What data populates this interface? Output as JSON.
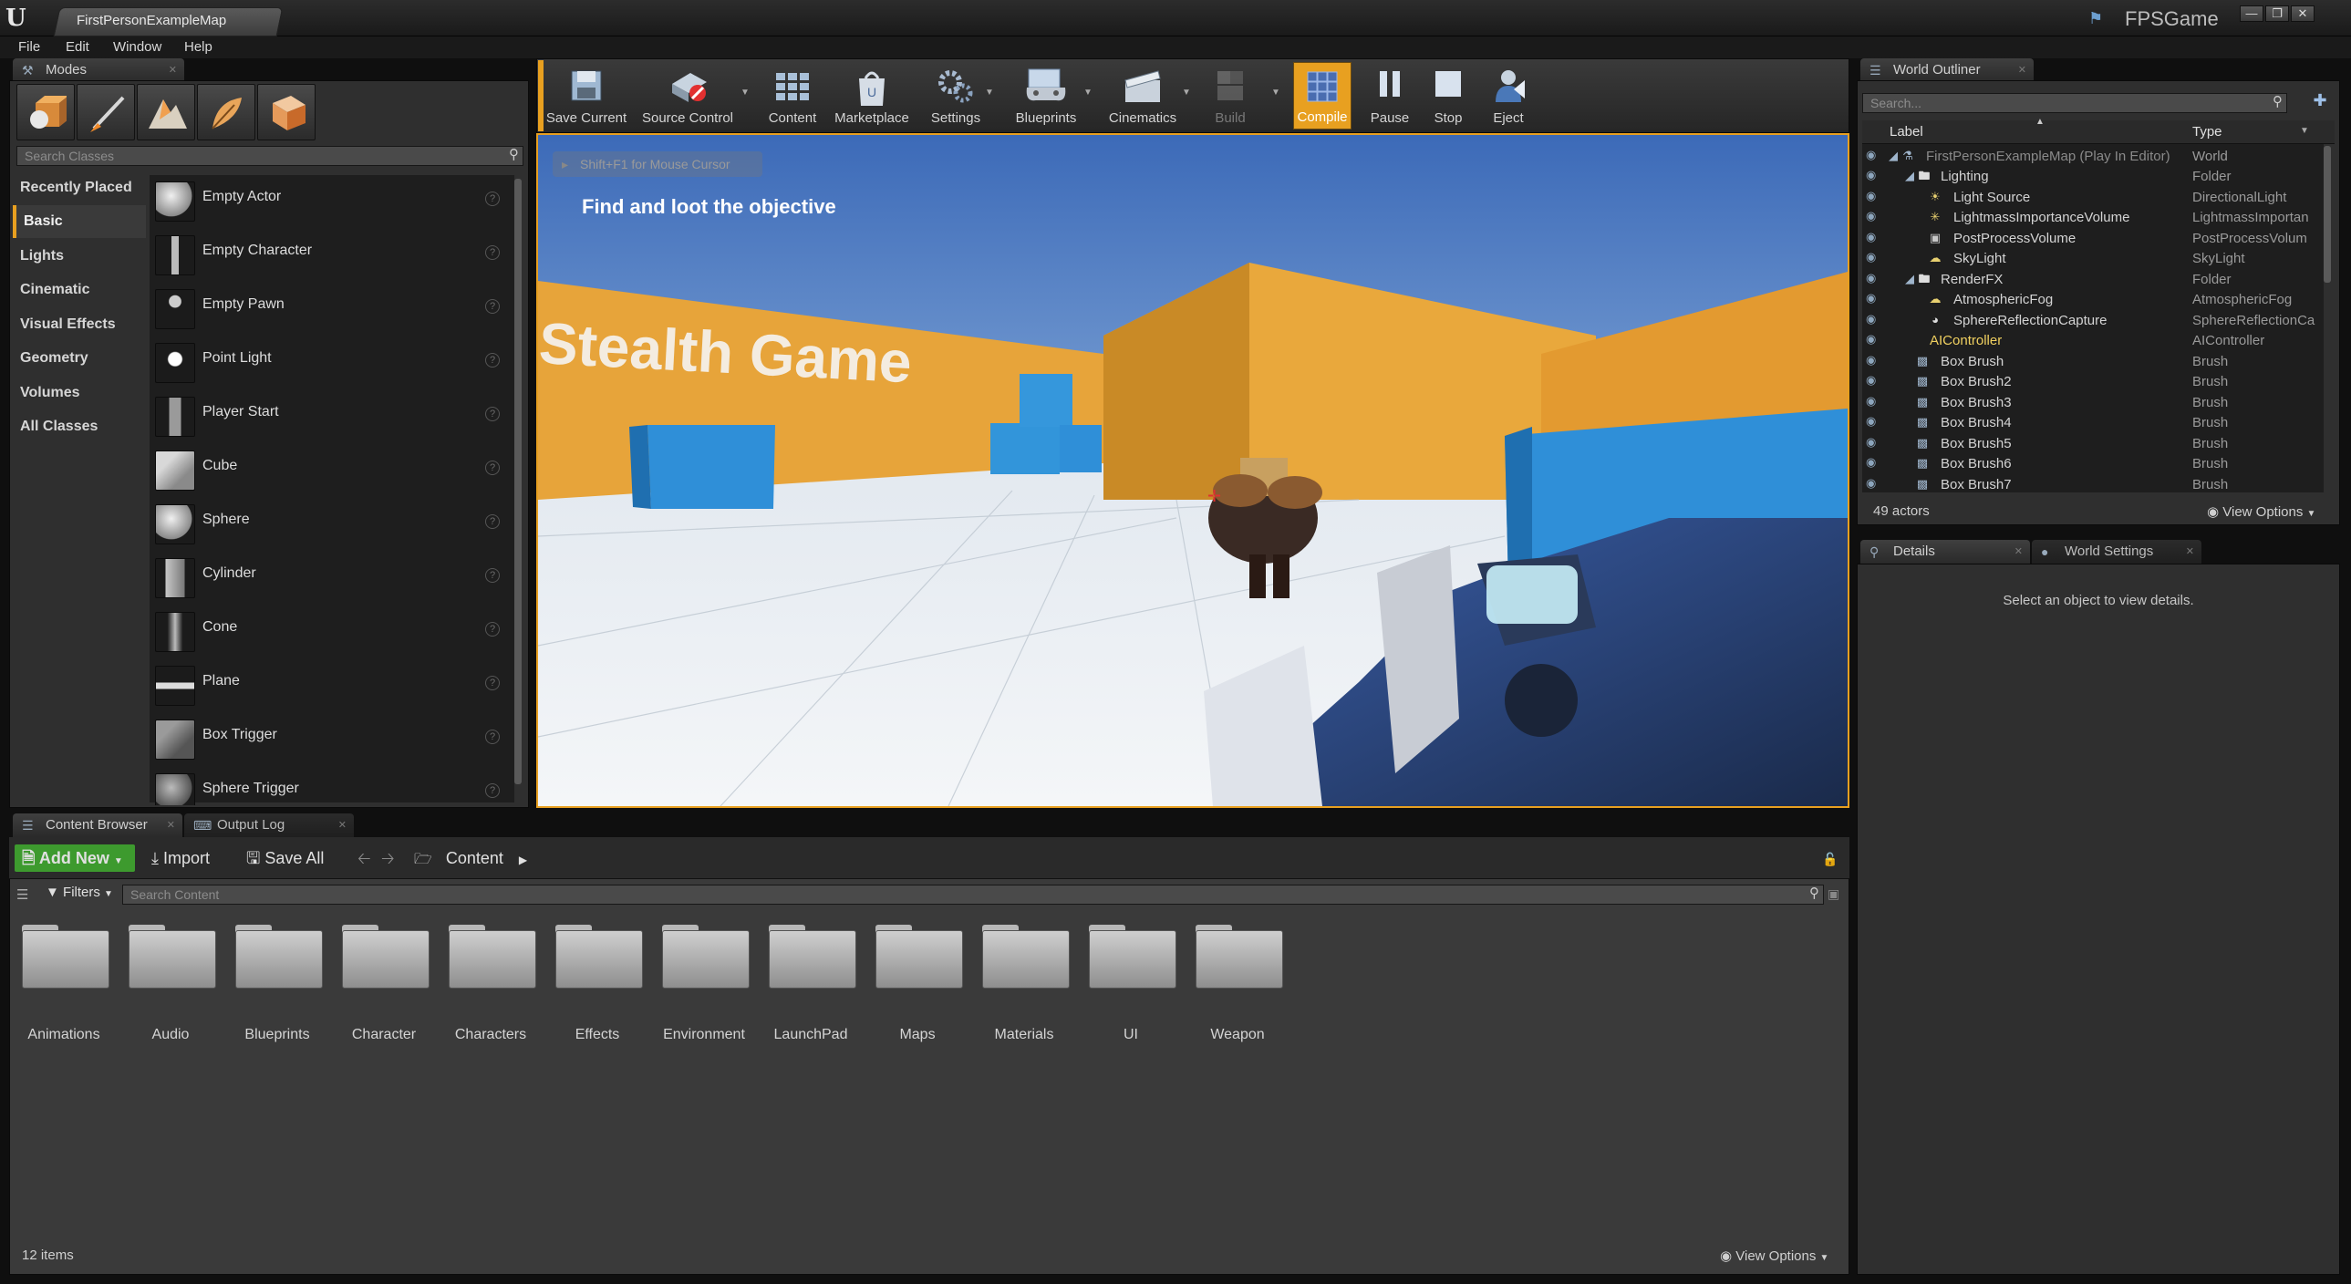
{
  "titlebar": {
    "map_tab": "FirstPersonExampleMap",
    "project": "FPSGame"
  },
  "menu": [
    "File",
    "Edit",
    "Window",
    "Help"
  ],
  "modes": {
    "tab_label": "Modes",
    "search_placeholder": "Search Classes",
    "categories": [
      "Recently Placed",
      "Basic",
      "Lights",
      "Cinematic",
      "Visual Effects",
      "Geometry",
      "Volumes",
      "All Classes"
    ],
    "selected_category": "Basic",
    "items": [
      "Empty Actor",
      "Empty Character",
      "Empty Pawn",
      "Point Light",
      "Player Start",
      "Cube",
      "Sphere",
      "Cylinder",
      "Cone",
      "Plane",
      "Box Trigger",
      "Sphere Trigger"
    ]
  },
  "toolbar": {
    "buttons": [
      "Save Current",
      "Source Control",
      "Content",
      "Marketplace",
      "Settings",
      "Blueprints",
      "Cinematics",
      "Build",
      "Compile",
      "Pause",
      "Stop",
      "Eject"
    ]
  },
  "viewport": {
    "hint": "Shift+F1 for Mouse Cursor",
    "objective": "Find and loot the objective",
    "wall_text": "Stealth Game"
  },
  "outliner": {
    "tab_label": "World Outliner",
    "search_placeholder": "Search...",
    "col_label": "Label",
    "col_type": "Type",
    "rows": [
      {
        "label": "FirstPersonExampleMap (Play In Editor)",
        "type": "World"
      },
      {
        "label": "Lighting",
        "type": "Folder"
      },
      {
        "label": "Light Source",
        "type": "DirectionalLight"
      },
      {
        "label": "LightmassImportanceVolume",
        "type": "LightmassImportan"
      },
      {
        "label": "PostProcessVolume",
        "type": "PostProcessVolum"
      },
      {
        "label": "SkyLight",
        "type": "SkyLight"
      },
      {
        "label": "RenderFX",
        "type": "Folder"
      },
      {
        "label": "AtmosphericFog",
        "type": "AtmosphericFog"
      },
      {
        "label": "SphereReflectionCapture",
        "type": "SphereReflectionCa"
      },
      {
        "label": "AIController",
        "type": "AIController"
      },
      {
        "label": "Box Brush",
        "type": "Brush"
      },
      {
        "label": "Box Brush2",
        "type": "Brush"
      },
      {
        "label": "Box Brush3",
        "type": "Brush"
      },
      {
        "label": "Box Brush4",
        "type": "Brush"
      },
      {
        "label": "Box Brush5",
        "type": "Brush"
      },
      {
        "label": "Box Brush6",
        "type": "Brush"
      },
      {
        "label": "Box Brush7",
        "type": "Brush"
      }
    ],
    "actor_count": "49 actors",
    "view_options": "View Options"
  },
  "details": {
    "tab_details": "Details",
    "tab_world_settings": "World Settings",
    "empty_message": "Select an object to view details."
  },
  "content_browser": {
    "tab_content_browser": "Content Browser",
    "tab_output_log": "Output Log",
    "add_new": "Add New",
    "import": "Import",
    "save_all": "Save All",
    "path": "Content",
    "filters": "Filters",
    "search_placeholder": "Search Content",
    "folders": [
      "Animations",
      "Audio",
      "Blueprints",
      "Character",
      "Characters",
      "Effects",
      "Environment",
      "LaunchPad",
      "Maps",
      "Materials",
      "UI",
      "Weapon"
    ],
    "item_count": "12 items",
    "view_options": "View Options"
  },
  "colors": {
    "accent": "#e8a020",
    "add_new_green": "#3d9a2e",
    "wall_orange": "#e7a43a",
    "cube_blue": "#2f8fd8"
  }
}
